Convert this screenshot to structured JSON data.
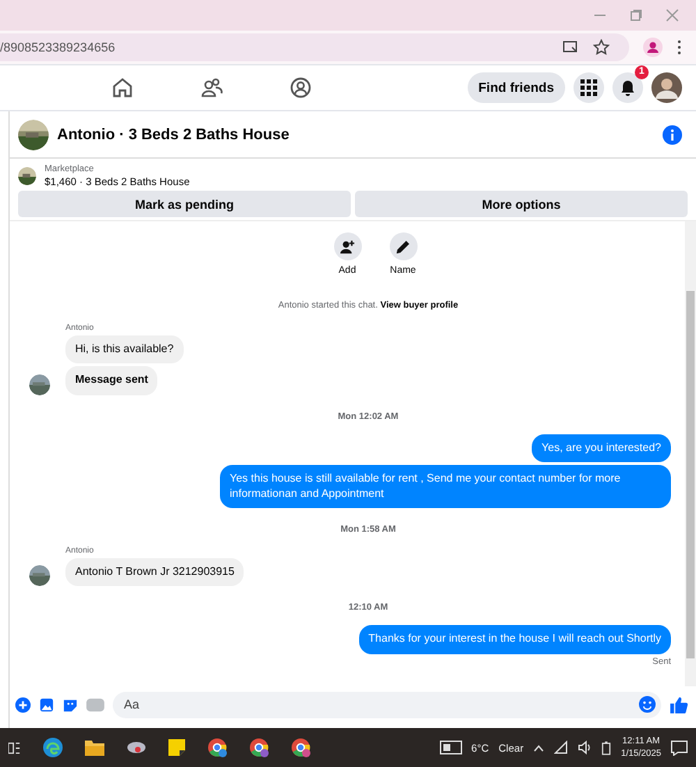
{
  "browser": {
    "url": "/8908523389234656"
  },
  "nav": {
    "find_friends": "Find friends",
    "notification_count": "1"
  },
  "chat": {
    "title": "Antonio · 3 Beds 2 Baths House",
    "listing_source": "Marketplace",
    "listing": "$1,460 · 3 Beds 2 Baths House",
    "actions": [
      "Mark as pending",
      "More options"
    ],
    "quick_actions": [
      {
        "kind": "add",
        "label": "Add"
      },
      {
        "kind": "name",
        "label": "Name"
      }
    ],
    "notice": {
      "text": "Antonio started this chat.",
      "link": "View buyer profile"
    },
    "messages": [
      {
        "kind": "received",
        "sender": "Antonio",
        "bubbles": [
          {
            "text": "Hi, is this available?",
            "bold": false
          },
          {
            "text": "Message sent",
            "bold": true
          }
        ]
      },
      {
        "kind": "time",
        "text": "Mon 12:02 AM"
      },
      {
        "kind": "sent",
        "bubbles": [
          {
            "text": "Yes, are you interested?",
            "bold": false
          },
          {
            "text": "Yes this house is still available for rent , Send me your contact number for more informationan and Appointment",
            "bold": false
          }
        ]
      },
      {
        "kind": "time",
        "text": "Mon 1:58 AM"
      },
      {
        "kind": "received",
        "sender": "Antonio",
        "bubbles": [
          {
            "text": "Antonio T Brown Jr  3212903915",
            "bold": false
          }
        ]
      },
      {
        "kind": "time",
        "text": "12:10 AM"
      },
      {
        "kind": "sent",
        "bubbles": [
          {
            "text": "Thanks for your interest in the house I will reach out Shortly",
            "bold": false
          }
        ],
        "status": "Sent"
      }
    ],
    "composer": {
      "placeholder": "Aa"
    }
  },
  "taskbar": {
    "temperature": "6°C",
    "weather": "Clear",
    "time": "12:11 AM",
    "date": "1/15/2025"
  }
}
